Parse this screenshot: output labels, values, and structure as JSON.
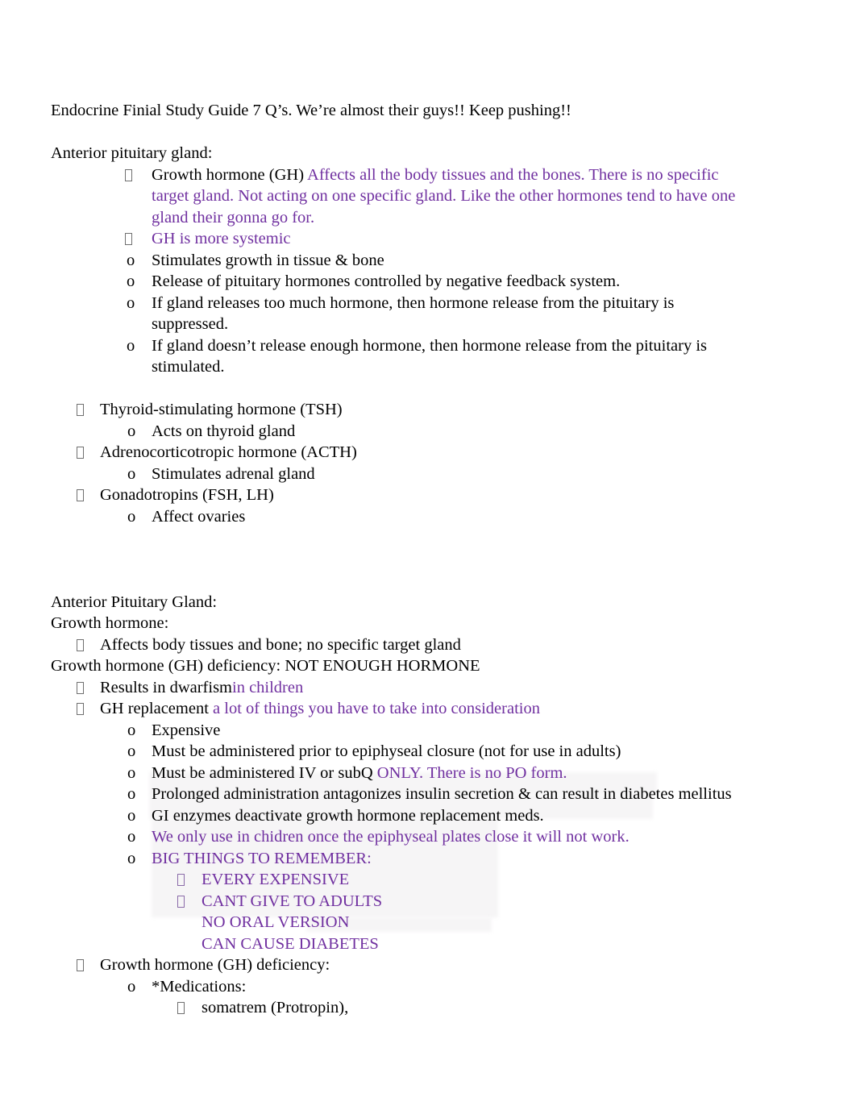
{
  "document": {
    "title_line": "Endocrine Finial Study Guide 7 Q’s. We’re almost their guys!! Keep pushing!!",
    "colors": {
      "text": "#000000",
      "accent_purple": "#7030a0",
      "highlight_shade": "#f6f5f6"
    },
    "markers": {
      "tofu_bullet": "missing-glyph-box-bullet",
      "circle_bullet": "o"
    },
    "sections": [
      {
        "heading": "Anterior pituitary gland:",
        "items": [
          {
            "marker": "tofu",
            "level": "b3",
            "runs": [
              {
                "text": "Growth hormone (GH) ",
                "color": "black"
              },
              {
                "text": "Affects all the body tissues and the bones. There is no specific target gland. Not acting on one specific gland. Like the other hormones tend to have one gland their gonna go for.",
                "color": "purple"
              }
            ]
          },
          {
            "marker": "tofu",
            "level": "b3",
            "runs": [
              {
                "text": "GH is more systemic",
                "color": "purple"
              }
            ]
          },
          {
            "marker": "o",
            "level": "o3",
            "runs": [
              {
                "text": "Stimulates growth in tissue & bone",
                "color": "black"
              }
            ]
          },
          {
            "marker": "o",
            "level": "o3",
            "runs": [
              {
                "text": "Release of pituitary hormones controlled by negative feedback system.",
                "color": "black"
              }
            ]
          },
          {
            "marker": "o",
            "level": "o3",
            "runs": [
              {
                "text": "If gland releases too much hormone, then hormone release from the pituitary is suppressed.",
                "color": "black"
              }
            ]
          },
          {
            "marker": "o",
            "level": "o3",
            "runs": [
              {
                "text": "If gland doesn’t release enough hormone, then hormone release from the pituitary is stimulated.",
                "color": "black"
              }
            ]
          }
        ]
      },
      {
        "heading": null,
        "items": [
          {
            "marker": "tofu",
            "level": "b1",
            "runs": [
              {
                "text": "Thyroid-stimulating hormone (TSH)",
                "color": "black"
              }
            ]
          },
          {
            "marker": "o",
            "level": "o2",
            "runs": [
              {
                "text": "Acts on thyroid gland",
                "color": "black"
              }
            ]
          },
          {
            "marker": "tofu",
            "level": "b1",
            "runs": [
              {
                "text": "Adrenocorticotropic hormone (ACTH)",
                "color": "black"
              }
            ]
          },
          {
            "marker": "o",
            "level": "o2",
            "runs": [
              {
                "text": "Stimulates adrenal gland",
                "color": "black"
              }
            ]
          },
          {
            "marker": "tofu",
            "level": "b1",
            "runs": [
              {
                "text": "Gonadotropins (FSH, LH)",
                "color": "black"
              }
            ]
          },
          {
            "marker": "o",
            "level": "o2",
            "runs": [
              {
                "text": "Affect ovaries",
                "color": "black"
              }
            ]
          }
        ]
      },
      {
        "heading": "Anterior Pituitary Gland:",
        "subheading": "Growth hormone:",
        "items": [
          {
            "marker": "tofu",
            "level": "b1",
            "runs": [
              {
                "text": "Affects body tissues and bone; no specific target gland",
                "color": "black"
              }
            ]
          }
        ]
      },
      {
        "heading2": "Growth hormone (GH) deficiency: NOT ENOUGH HORMONE",
        "items": [
          {
            "marker": "tofu",
            "level": "b1",
            "runs": [
              {
                "text": "Results in dwarfism",
                "color": "black"
              },
              {
                "text": "in children",
                "color": "purple"
              }
            ]
          },
          {
            "marker": "tofu",
            "level": "b1",
            "runs": [
              {
                "text": "GH replacement ",
                "color": "black"
              },
              {
                "text": "a lot of things you have to take into consideration",
                "color": "purple"
              }
            ]
          },
          {
            "marker": "o",
            "level": "o2",
            "runs": [
              {
                "text": "Expensive",
                "color": "black"
              }
            ]
          },
          {
            "marker": "o",
            "level": "o2",
            "runs": [
              {
                "text": "Must be administered prior to epiphyseal closure (not for use in adults)",
                "color": "black"
              }
            ]
          },
          {
            "marker": "o",
            "level": "o2",
            "runs": [
              {
                "text": "Must be administered IV or subQ ",
                "color": "black"
              },
              {
                "text": "ONLY. There is no PO form.",
                "color": "purple"
              }
            ]
          },
          {
            "marker": "o",
            "level": "o2",
            "runs": [
              {
                "text": "Prolonged administration antagonizes insulin secretion & can result in diabetes mellitus",
                "color": "black"
              }
            ]
          },
          {
            "marker": "o",
            "level": "o2",
            "runs": [
              {
                "text": "GI enzymes deactivate growth hormone replacement meds.",
                "color": "black"
              }
            ]
          },
          {
            "marker": "o",
            "level": "o2",
            "runs": [
              {
                "text": "We only use in chidren once the epiphyseal plates close it will not work.",
                "color": "purple"
              }
            ]
          },
          {
            "marker": "o",
            "level": "o2",
            "runs": [
              {
                "text": "BIG THINGS TO REMEMBER:",
                "color": "purple"
              }
            ]
          },
          {
            "marker": "tofu-purple",
            "level": "b4",
            "runs": [
              {
                "text": "EVERY EXPENSIVE",
                "color": "purple"
              }
            ]
          },
          {
            "marker": "tofu-purple",
            "level": "b4",
            "runs": [
              {
                "text": "CANT GIVE TO ADULTS",
                "color": "purple"
              }
            ]
          },
          {
            "marker": "none",
            "level": "none4",
            "runs": [
              {
                "text": "NO ORAL VERSION",
                "color": "purple"
              }
            ]
          },
          {
            "marker": "none",
            "level": "none4",
            "runs": [
              {
                "text": "CAN CAUSE DIABETES",
                "color": "purple"
              }
            ]
          },
          {
            "marker": "tofu",
            "level": "b1",
            "runs": [
              {
                "text": "Growth hormone (GH) deficiency:",
                "color": "black"
              }
            ]
          },
          {
            "marker": "o",
            "level": "o2",
            "runs": [
              {
                "text": "*Medications:",
                "color": "black"
              }
            ]
          },
          {
            "marker": "tofu",
            "level": "b4",
            "runs": [
              {
                "text": " somatrem (Protropin),",
                "color": "black"
              }
            ]
          }
        ]
      }
    ]
  }
}
